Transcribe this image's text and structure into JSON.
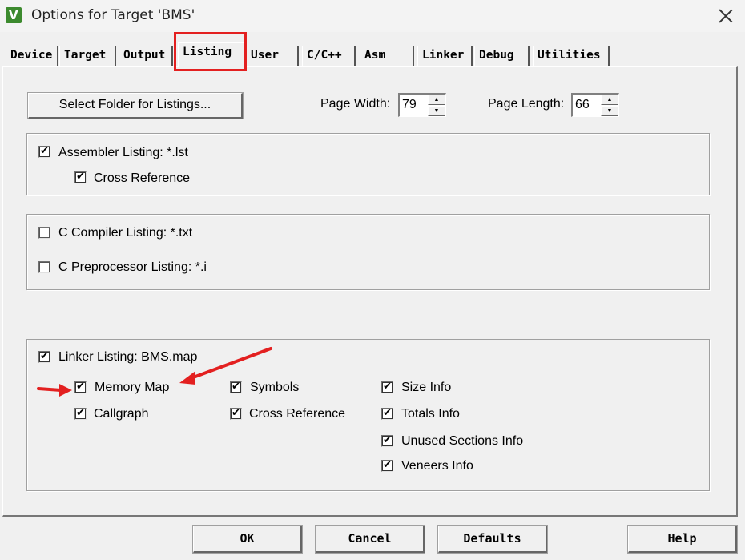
{
  "window": {
    "title": "Options for Target 'BMS'",
    "icon_letter": "V"
  },
  "tabs": [
    "Device",
    "Target",
    "Output",
    "Listing",
    "User",
    "C/C++",
    "Asm",
    "Linker",
    "Debug",
    "Utilities"
  ],
  "active_tab": "Listing",
  "listing": {
    "select_folder_label": "Select Folder for Listings...",
    "page_width_label": "Page Width:",
    "page_width_value": "79",
    "page_length_label": "Page Length:",
    "page_length_value": "66",
    "assembler": {
      "label": "Assembler Listing:  *.lst",
      "checked": true,
      "cross_reference": {
        "label": "Cross Reference",
        "checked": true
      }
    },
    "c_compiler": {
      "label": "C Compiler Listing:  *.txt",
      "checked": false
    },
    "c_preprocessor": {
      "label": "C Preprocessor Listing:  *.i",
      "checked": false
    },
    "linker": {
      "label": "Linker Listing:  BMS.map",
      "checked": true,
      "memory_map": {
        "label": "Memory Map",
        "checked": true
      },
      "callgraph": {
        "label": "Callgraph",
        "checked": true
      },
      "symbols": {
        "label": "Symbols",
        "checked": true
      },
      "cross_reference": {
        "label": "Cross Reference",
        "checked": true
      },
      "size_info": {
        "label": "Size Info",
        "checked": true
      },
      "totals_info": {
        "label": "Totals Info",
        "checked": true
      },
      "unused_sections_info": {
        "label": "Unused Sections Info",
        "checked": true
      },
      "veneers_info": {
        "label": "Veneers Info",
        "checked": true
      }
    }
  },
  "buttons": {
    "ok": "OK",
    "cancel": "Cancel",
    "defaults": "Defaults",
    "help": "Help"
  },
  "annotation_color": "#e32020",
  "check_glyph": "✔"
}
